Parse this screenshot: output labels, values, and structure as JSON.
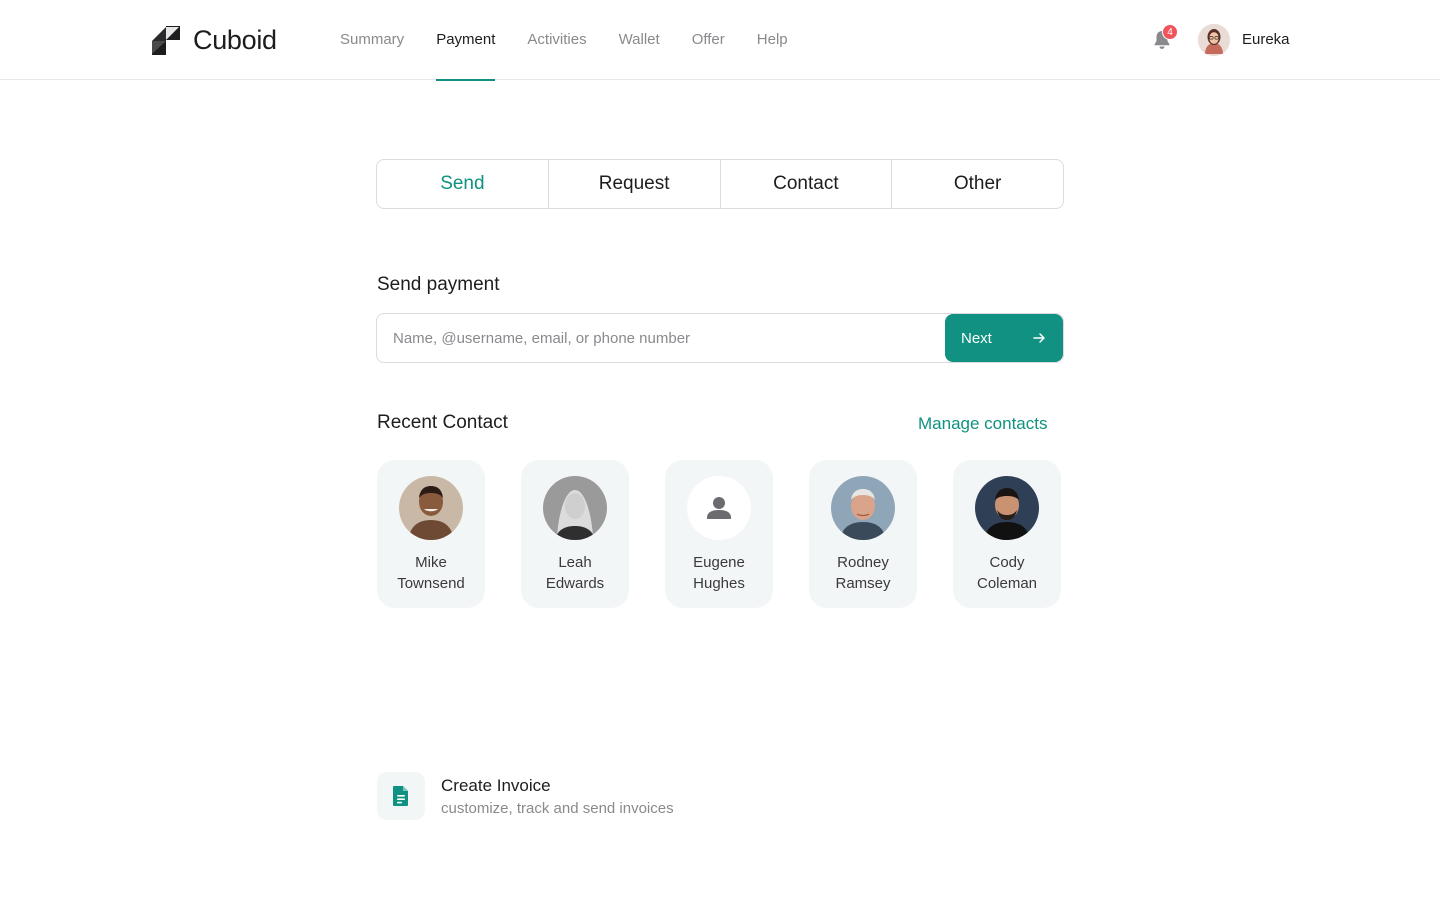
{
  "app": {
    "name": "Cuboid"
  },
  "nav": {
    "items": [
      {
        "label": "Summary",
        "active": false
      },
      {
        "label": "Payment",
        "active": true
      },
      {
        "label": "Activities",
        "active": false
      },
      {
        "label": "Wallet",
        "active": false
      },
      {
        "label": "Offer",
        "active": false
      },
      {
        "label": "Help",
        "active": false
      }
    ]
  },
  "notifications": {
    "icon": "bell-icon",
    "count": "4"
  },
  "user": {
    "name": "Eureka",
    "avatar": "user-avatar"
  },
  "tabs": [
    {
      "label": "Send",
      "active": true
    },
    {
      "label": "Request",
      "active": false
    },
    {
      "label": "Contact",
      "active": false
    },
    {
      "label": "Other",
      "active": false
    }
  ],
  "send_payment": {
    "title": "Send payment",
    "placeholder": "Name, @username, email, or phone number",
    "value": "",
    "next_label": "Next",
    "next_icon": "arrow-right-icon"
  },
  "recent": {
    "title": "Recent Contact",
    "manage_label": "Manage contacts",
    "contacts": [
      {
        "first": "Mike",
        "last": "Townsend"
      },
      {
        "first": "Leah",
        "last": "Edwards"
      },
      {
        "first": "Eugene",
        "last": "Hughes"
      },
      {
        "first": "Rodney",
        "last": "Ramsey"
      },
      {
        "first": "Cody",
        "last": "Coleman"
      }
    ]
  },
  "invoice": {
    "icon": "document-icon",
    "title": "Create Invoice",
    "subtitle": "customize, track and send invoices"
  },
  "colors": {
    "accent": "#109181",
    "badge": "#f2545b",
    "card_bg": "#f3f6f7",
    "muted_text": "#8a8a8e"
  }
}
